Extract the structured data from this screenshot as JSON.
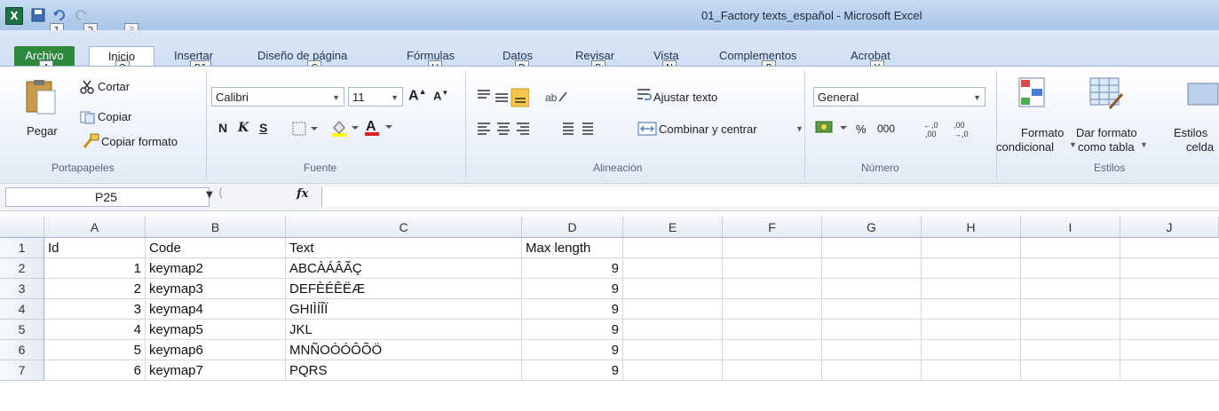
{
  "window": {
    "title": "01_Factory texts_español - Microsoft Excel",
    "app_icon": "X",
    "qat_keytips": [
      "1",
      "2",
      "3"
    ]
  },
  "tabs": [
    {
      "label": "Archivo",
      "keytip": "A"
    },
    {
      "label": "Inicio",
      "keytip": "O"
    },
    {
      "label": "Insertar",
      "keytip": "B1"
    },
    {
      "label": "Diseño de página",
      "keytip": "C"
    },
    {
      "label": "Fórmulas",
      "keytip": "U"
    },
    {
      "label": "Datos",
      "keytip": "D"
    },
    {
      "label": "Revisar",
      "keytip": "R"
    },
    {
      "label": "Vista",
      "keytip": "N"
    },
    {
      "label": "Complementos",
      "keytip": "P"
    },
    {
      "label": "Acrobat",
      "keytip": "Y"
    }
  ],
  "clipboard": {
    "paste": "Pegar",
    "cut": "Cortar",
    "copy": "Copiar",
    "format_painter": "Copiar formato",
    "group": "Portapapeles"
  },
  "font": {
    "name": "Calibri",
    "size": "11",
    "bold": "N",
    "italic": "K",
    "underline": "S",
    "group": "Fuente"
  },
  "alignment": {
    "wrap": "Ajustar texto",
    "merge": "Combinar y centrar",
    "group": "Alineación"
  },
  "number": {
    "format": "General",
    "percent": "%",
    "thousands": "000",
    "group": "Número"
  },
  "styles": {
    "conditional_line1": "Formato",
    "conditional_line2": "condicional",
    "table_line1": "Dar formato",
    "table_line2": "como tabla",
    "cell_line1": "Estilos",
    "cell_line2": "celda",
    "group": "Estilos"
  },
  "formula_bar": {
    "name_box": "P25",
    "fx": "fx",
    "content": ""
  },
  "grid": {
    "columns": [
      "A",
      "B",
      "C",
      "D",
      "E",
      "F",
      "G",
      "H",
      "I",
      "J"
    ],
    "rows": [
      {
        "n": "1",
        "a": "Id",
        "b": "Code",
        "c": "Text",
        "d": "Max length"
      },
      {
        "n": "2",
        "a": "1",
        "b": "keymap2",
        "c": "ABCÀÁÂÃÇ",
        "d": "9"
      },
      {
        "n": "3",
        "a": "2",
        "b": "keymap3",
        "c": "DEFÈÉÊËÆ",
        "d": "9"
      },
      {
        "n": "4",
        "a": "3",
        "b": "keymap4",
        "c": "GHIÌÍÎÏ",
        "d": "9"
      },
      {
        "n": "5",
        "a": "4",
        "b": "keymap5",
        "c": "JKL",
        "d": "9"
      },
      {
        "n": "6",
        "a": "5",
        "b": "keymap6",
        "c": "MNÑOÒÓÔÕÖ",
        "d": "9"
      },
      {
        "n": "7",
        "a": "6",
        "b": "keymap7",
        "c": "PQRS",
        "d": "9"
      }
    ]
  },
  "colors": {
    "archivo": "#2d8a3d",
    "excel_green": "#1e7145",
    "ribbon_border": "#9cb4d3"
  }
}
